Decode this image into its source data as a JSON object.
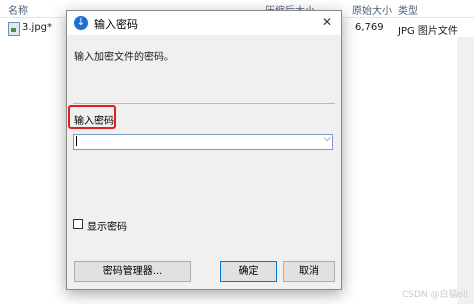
{
  "file_list": {
    "columns": [
      "名称",
      "压缩后大小",
      "原始大小",
      "类型"
    ],
    "rows": [
      {
        "name": "3.jpg*",
        "original_size": "6,769",
        "type": "JPG 图片文件"
      }
    ]
  },
  "watermark": "CSDN @白猫oli",
  "dialog": {
    "title": "输入密码",
    "close_glyph": "✕",
    "prompt": "输入加密文件的密码。",
    "password_label": "输入密码",
    "password_value": "",
    "show_password_label": "显示密码",
    "show_password_checked": false,
    "buttons": {
      "manager": "密码管理器...",
      "ok": "确定",
      "cancel": "取消"
    }
  },
  "colors": {
    "highlight_border": "#e02020",
    "dialog_bg": "#f0f0f0",
    "title_icon": "#1f6fce"
  }
}
